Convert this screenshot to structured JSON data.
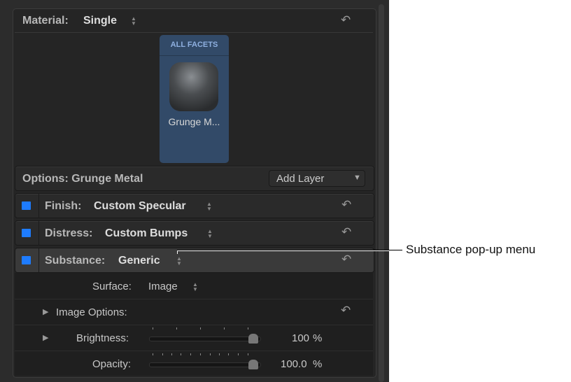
{
  "material": {
    "label": "Material:",
    "value": "Single"
  },
  "facet": {
    "header": "ALL FACETS",
    "name": "Grunge M..."
  },
  "options": {
    "label": "Options: Grunge Metal",
    "add_layer": "Add Layer"
  },
  "layers": [
    {
      "label": "Finish:",
      "value": "Custom Specular"
    },
    {
      "label": "Distress:",
      "value": "Custom Bumps"
    },
    {
      "label": "Substance:",
      "value": "Generic"
    }
  ],
  "surface": {
    "label": "Surface:",
    "value": "Image"
  },
  "image_options": {
    "label": "Image Options:"
  },
  "brightness": {
    "label": "Brightness:",
    "value": "100",
    "unit": "%",
    "fraction": 1.0
  },
  "opacity": {
    "label": "Opacity:",
    "value": "100.0",
    "unit": "%",
    "fraction": 1.0
  },
  "callout": "Substance pop-up menu",
  "colors": {
    "accent": "#1e7cff",
    "facet": "#324a68"
  }
}
